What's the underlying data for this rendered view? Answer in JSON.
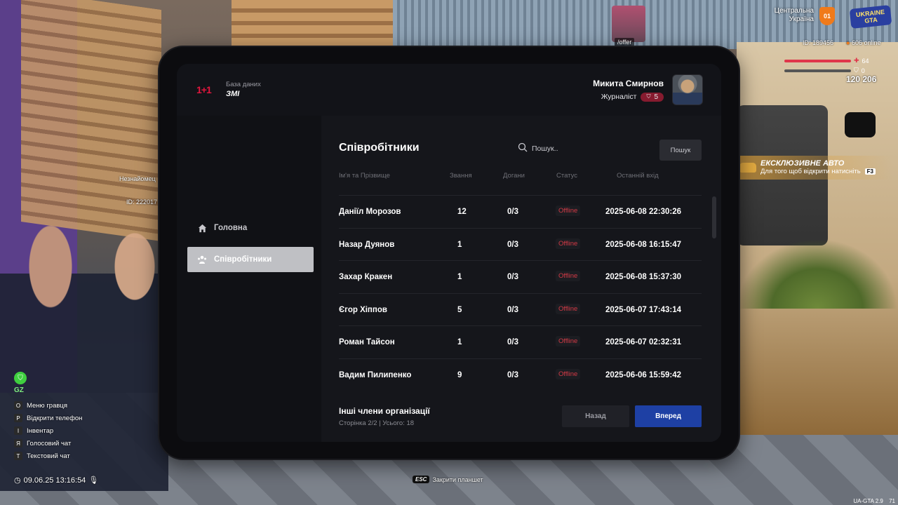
{
  "hud": {
    "region_line1": "Центральна",
    "region_line2": "Україна",
    "shield_number": "01",
    "logo_line1": "UKRAINE",
    "logo_line2": "GTA",
    "player_id": "ID: 189456",
    "online": "606 online",
    "health": "64",
    "armor": "0",
    "money": "120 206",
    "offer_label": "/offer",
    "exclusive_title": "ЕКСКЛЮЗИВНЕ АВТО",
    "exclusive_subtitle": "Для того щоб відкрити натисніть",
    "exclusive_key": "F3",
    "npc_unknown": "Незнайомец",
    "npc_id": "ID: 222017",
    "gz": "GZ",
    "hints": [
      {
        "key": "O",
        "label": "Меню гравця"
      },
      {
        "key": "P",
        "label": "Відкрити телефон"
      },
      {
        "key": "I",
        "label": "Інвентар"
      },
      {
        "key": "Я",
        "label": "Голосовий чат"
      },
      {
        "key": "Т",
        "label": "Текстовий чат"
      }
    ],
    "datetime": "09.06.25 13:16:54",
    "esc_key": "ESC",
    "esc_label": "Закрити планшет",
    "version": "UA-GTA 2.9",
    "fps": "71"
  },
  "tablet": {
    "brand_logo": "1+1",
    "brand_sub": "База даних",
    "brand_title": "ЗМІ",
    "profile": {
      "name": "Микита Смирнов",
      "role": "Журналіст",
      "rank": "5"
    },
    "nav": [
      {
        "label": "Головна",
        "icon": "home-icon"
      },
      {
        "label": "Співробітники",
        "icon": "users-icon"
      }
    ],
    "section_title": "Співробітники",
    "search": {
      "placeholder": "Пошук..",
      "button": "Пошук"
    },
    "columns": [
      "Ім'я та Прізвище",
      "Звання",
      "Догани",
      "Статус",
      "Останній вхід"
    ],
    "rows": [
      {
        "name": "Даніїл Морозов",
        "rank": "12",
        "warnings": "0/3",
        "status": "Offline",
        "last_login": "2025-06-08 22:30:26"
      },
      {
        "name": "Назар Дуянов",
        "rank": "1",
        "warnings": "0/3",
        "status": "Offline",
        "last_login": "2025-06-08 16:15:47"
      },
      {
        "name": "Захар Кракен",
        "rank": "1",
        "warnings": "0/3",
        "status": "Offline",
        "last_login": "2025-06-08 15:37:30"
      },
      {
        "name": "Єгор Хіппов",
        "rank": "5",
        "warnings": "0/3",
        "status": "Offline",
        "last_login": "2025-06-07 17:43:14"
      },
      {
        "name": "Роман Тайсон",
        "rank": "1",
        "warnings": "0/3",
        "status": "Offline",
        "last_login": "2025-06-07 02:32:31"
      },
      {
        "name": "Вадим Пилипенко",
        "rank": "9",
        "warnings": "0/3",
        "status": "Offline",
        "last_login": "2025-06-06 15:59:42"
      }
    ],
    "footer": {
      "title": "Інші члени організації",
      "info": "Сторінка 2/2 | Усього: 18",
      "back": "Назад",
      "next": "Вперед"
    }
  },
  "colors": {
    "accent_blue": "#1e40a4",
    "offline_red": "#d33a46",
    "brand_red": "#e0163d",
    "rank_pill": "#861b2f"
  }
}
